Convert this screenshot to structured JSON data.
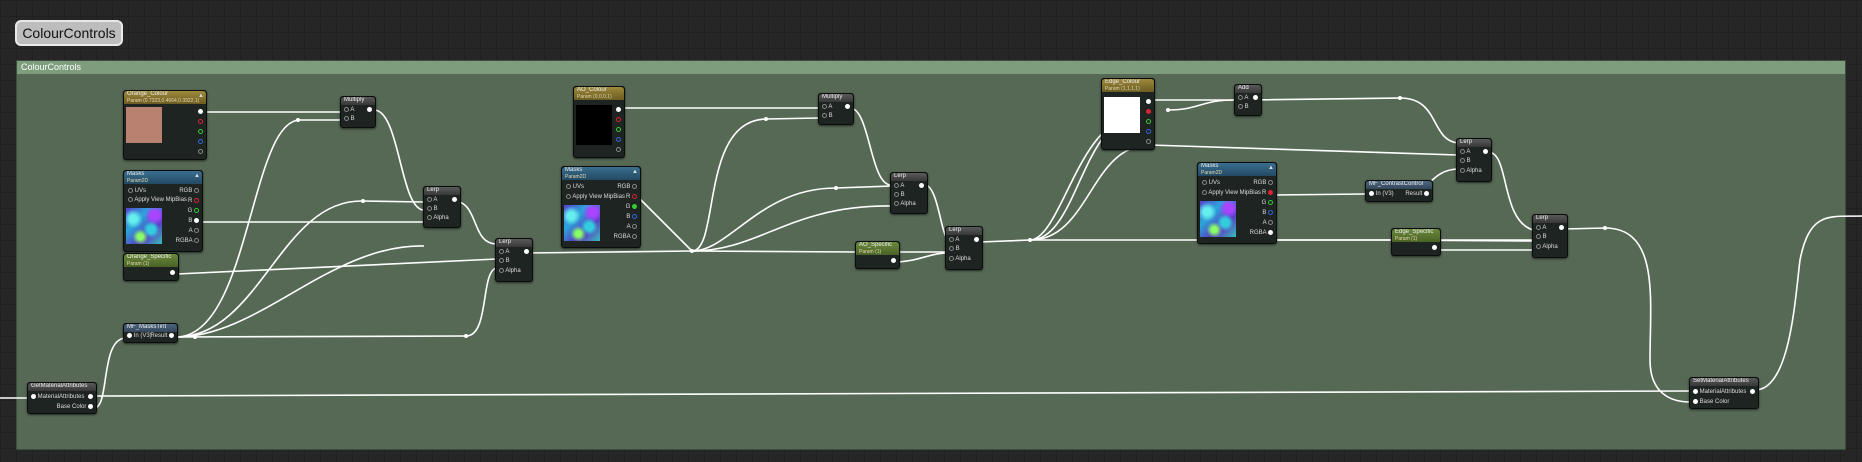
{
  "title_tab": "ColourControls",
  "comment_header": "ColourControls",
  "nodes": {
    "orange_colour": {
      "title": "Orange_Colour",
      "subtitle": "Param (0.7323,0.4664,0.3922,1)",
      "pins": [
        "",
        "",
        "",
        "",
        ""
      ]
    },
    "masks1": {
      "title": "Masks",
      "subtitle": "Param2D",
      "uvs": "UVs",
      "apply": "Apply View MipBias",
      "outs": [
        "RGB",
        "R",
        "G",
        "B",
        "A",
        "RGBA"
      ]
    },
    "orange_specific": {
      "title": "Orange_Specific",
      "subtitle": "Param (1)"
    },
    "mf_maskstint": {
      "title": "MF_MasksTint",
      "in": "In (V3)",
      "out": "Result"
    },
    "multiply1": {
      "title": "Multiply",
      "a": "A",
      "b": "B"
    },
    "lerp1": {
      "title": "Lerp",
      "a": "A",
      "b": "B",
      "alpha": "Alpha"
    },
    "lerp2": {
      "title": "Lerp",
      "a": "A",
      "b": "B",
      "alpha": "Alpha"
    },
    "ao_colour": {
      "title": "AO_Colour",
      "subtitle": "Param (0,0,0,1)"
    },
    "masks2": {
      "title": "Masks",
      "subtitle": "Param2D",
      "uvs": "UVs",
      "apply": "Apply View MipBias",
      "outs": [
        "RGB",
        "R",
        "G",
        "B",
        "A",
        "RGBA"
      ]
    },
    "multiply2": {
      "title": "Multiply",
      "a": "A",
      "b": "B"
    },
    "ao_specific": {
      "title": "AO_Specific",
      "subtitle": "Param (1)"
    },
    "lerp3": {
      "title": "Lerp",
      "a": "A",
      "b": "B",
      "alpha": "Alpha"
    },
    "lerp4": {
      "title": "Lerp",
      "a": "A",
      "b": "B",
      "alpha": "Alpha"
    },
    "edge_colour": {
      "title": "Edge_Colour",
      "subtitle": "Param (1,1,1,1)"
    },
    "add": {
      "title": "Add",
      "a": "A",
      "b": "B"
    },
    "masks3": {
      "title": "Masks",
      "subtitle": "Param2D",
      "uvs": "UVs",
      "apply": "Apply View MipBias",
      "outs": [
        "RGB",
        "R",
        "G",
        "B",
        "A",
        "RGBA"
      ]
    },
    "mf_contrastcontrol": {
      "title": "MF_ContrastControl",
      "in": "In (V3)",
      "out": "Result"
    },
    "edge_specific": {
      "title": "Edge_Specific",
      "subtitle": "Param (1)"
    },
    "lerp5": {
      "title": "Lerp",
      "a": "A",
      "b": "B",
      "alpha": "Alpha"
    },
    "lerp6": {
      "title": "Lerp",
      "a": "A",
      "b": "B",
      "alpha": "Alpha"
    },
    "getmat": {
      "title": "GetMaterialAttributes",
      "mat": "MaterialAttributes",
      "base": "Base Color"
    },
    "setmat": {
      "title": "SetMaterialAttributes",
      "mat": "MaterialAttributes",
      "base": "Base Color"
    }
  },
  "colors": {
    "orange_swatch": "#b98170",
    "ao_swatch": "#000000",
    "edge_swatch": "#ffffff",
    "comment_bg": "#566955",
    "comment_header": "#7e9d7c"
  }
}
